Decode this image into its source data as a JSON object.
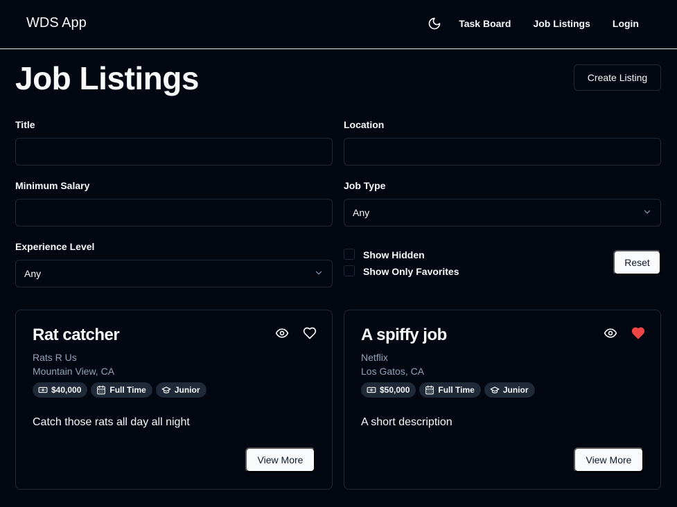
{
  "header": {
    "brand": "WDS App",
    "nav": [
      "Task Board",
      "Job Listings",
      "Login"
    ],
    "theme_icon": "moon-icon"
  },
  "page": {
    "title": "Job Listings",
    "create_button": "Create Listing"
  },
  "filters": {
    "title_label": "Title",
    "title_value": "",
    "location_label": "Location",
    "location_value": "",
    "min_salary_label": "Minimum Salary",
    "min_salary_value": "",
    "job_type_label": "Job Type",
    "job_type_value": "Any",
    "experience_label": "Experience Level",
    "experience_value": "Any",
    "show_hidden_label": "Show Hidden",
    "show_favorites_label": "Show Only Favorites",
    "reset_button": "Reset"
  },
  "listings": [
    {
      "title": "Rat catcher",
      "company": "Rats R Us",
      "location": "Mountain View, CA",
      "salary": "$40,000",
      "type": "Full Time",
      "level": "Junior",
      "description": "Catch those rats all day all night",
      "favorite": false,
      "view_more": "View More"
    },
    {
      "title": "A spiffy job",
      "company": "Netflix",
      "location": "Los Gatos, CA",
      "salary": "$50,000",
      "type": "Full Time",
      "level": "Junior",
      "description": "A short description",
      "favorite": true,
      "view_more": "View More"
    }
  ],
  "colors": {
    "background": "#030712",
    "border": "#1f2937",
    "muted_text": "#94a3b8",
    "favorite_heart": "#ef4444"
  }
}
